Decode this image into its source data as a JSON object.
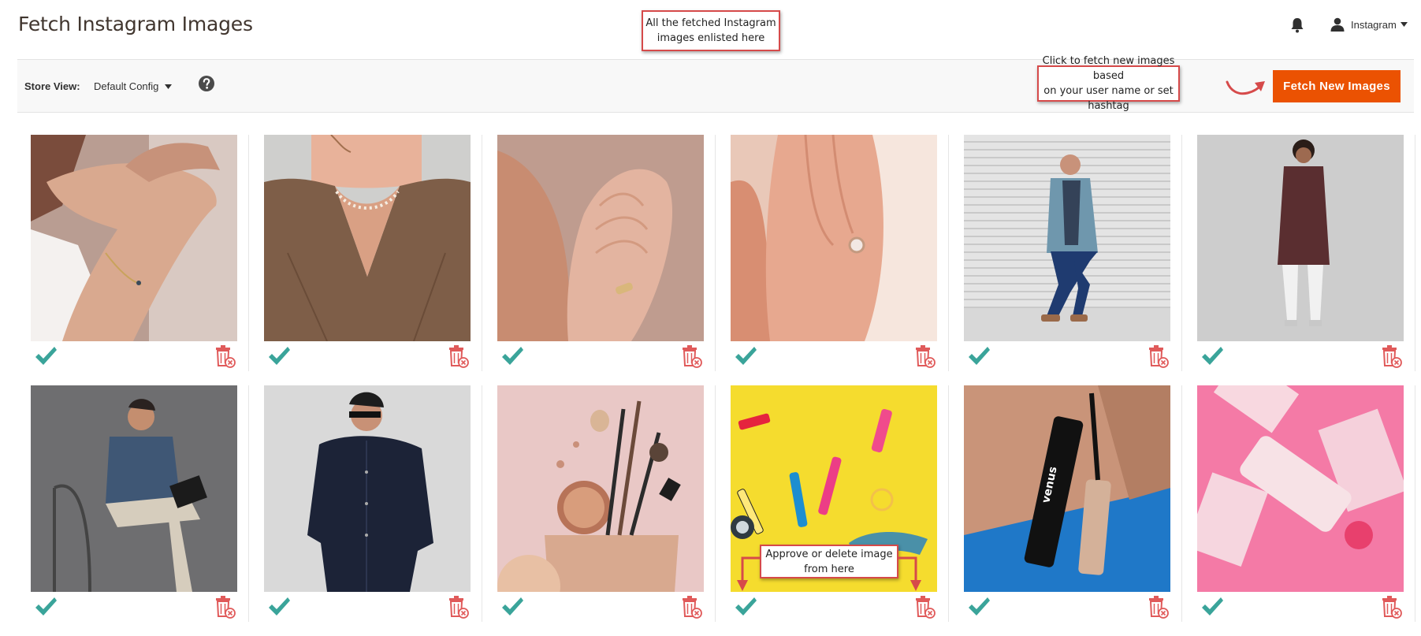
{
  "header": {
    "title": "Fetch Instagram Images",
    "user_name": "Instagram"
  },
  "toolbar": {
    "store_view_label": "Store View:",
    "store_view_value": "Default Config",
    "fetch_button_label": "Fetch New Images"
  },
  "callouts": {
    "fetched_images": "All the fetched Instagram\nimages enlisted here",
    "fetch_new": "Click to fetch new images based\non your user name or set hashtag",
    "approve_delete": "Approve or delete image\nfrom here"
  },
  "images": [
    {
      "subject": "bracelet on wrist",
      "status_icons": [
        "check-icon",
        "trash-icon"
      ]
    },
    {
      "subject": "pearl necklace",
      "status_icons": [
        "check-icon",
        "trash-icon"
      ]
    },
    {
      "subject": "hands with ring",
      "status_icons": [
        "check-icon",
        "trash-icon"
      ]
    },
    {
      "subject": "diamond ring on finger",
      "status_icons": [
        "check-icon",
        "trash-icon"
      ]
    },
    {
      "subject": "man in blue blazer",
      "status_icons": [
        "check-icon",
        "trash-icon"
      ]
    },
    {
      "subject": "woman in kurta",
      "status_icons": [
        "check-icon",
        "trash-icon"
      ]
    },
    {
      "subject": "man reading on chair",
      "status_icons": [
        "check-icon",
        "trash-icon"
      ]
    },
    {
      "subject": "man in navy shirt",
      "status_icons": [
        "check-icon",
        "trash-icon"
      ]
    },
    {
      "subject": "makeup brushes and pouch",
      "status_icons": [
        "check-icon",
        "trash-icon"
      ]
    },
    {
      "subject": "lipsticks on yellow",
      "status_icons": [
        "check-icon",
        "trash-icon"
      ]
    },
    {
      "subject": "mascara tube",
      "status_icons": [
        "check-icon",
        "trash-icon"
      ]
    },
    {
      "subject": "pink cosmetic boxes",
      "status_icons": [
        "check-icon",
        "trash-icon"
      ]
    }
  ],
  "colors": {
    "accent": "#eb5202",
    "approve": "#3aa49a",
    "delete": "#e05a5a",
    "callout_border": "#d64a4a"
  }
}
